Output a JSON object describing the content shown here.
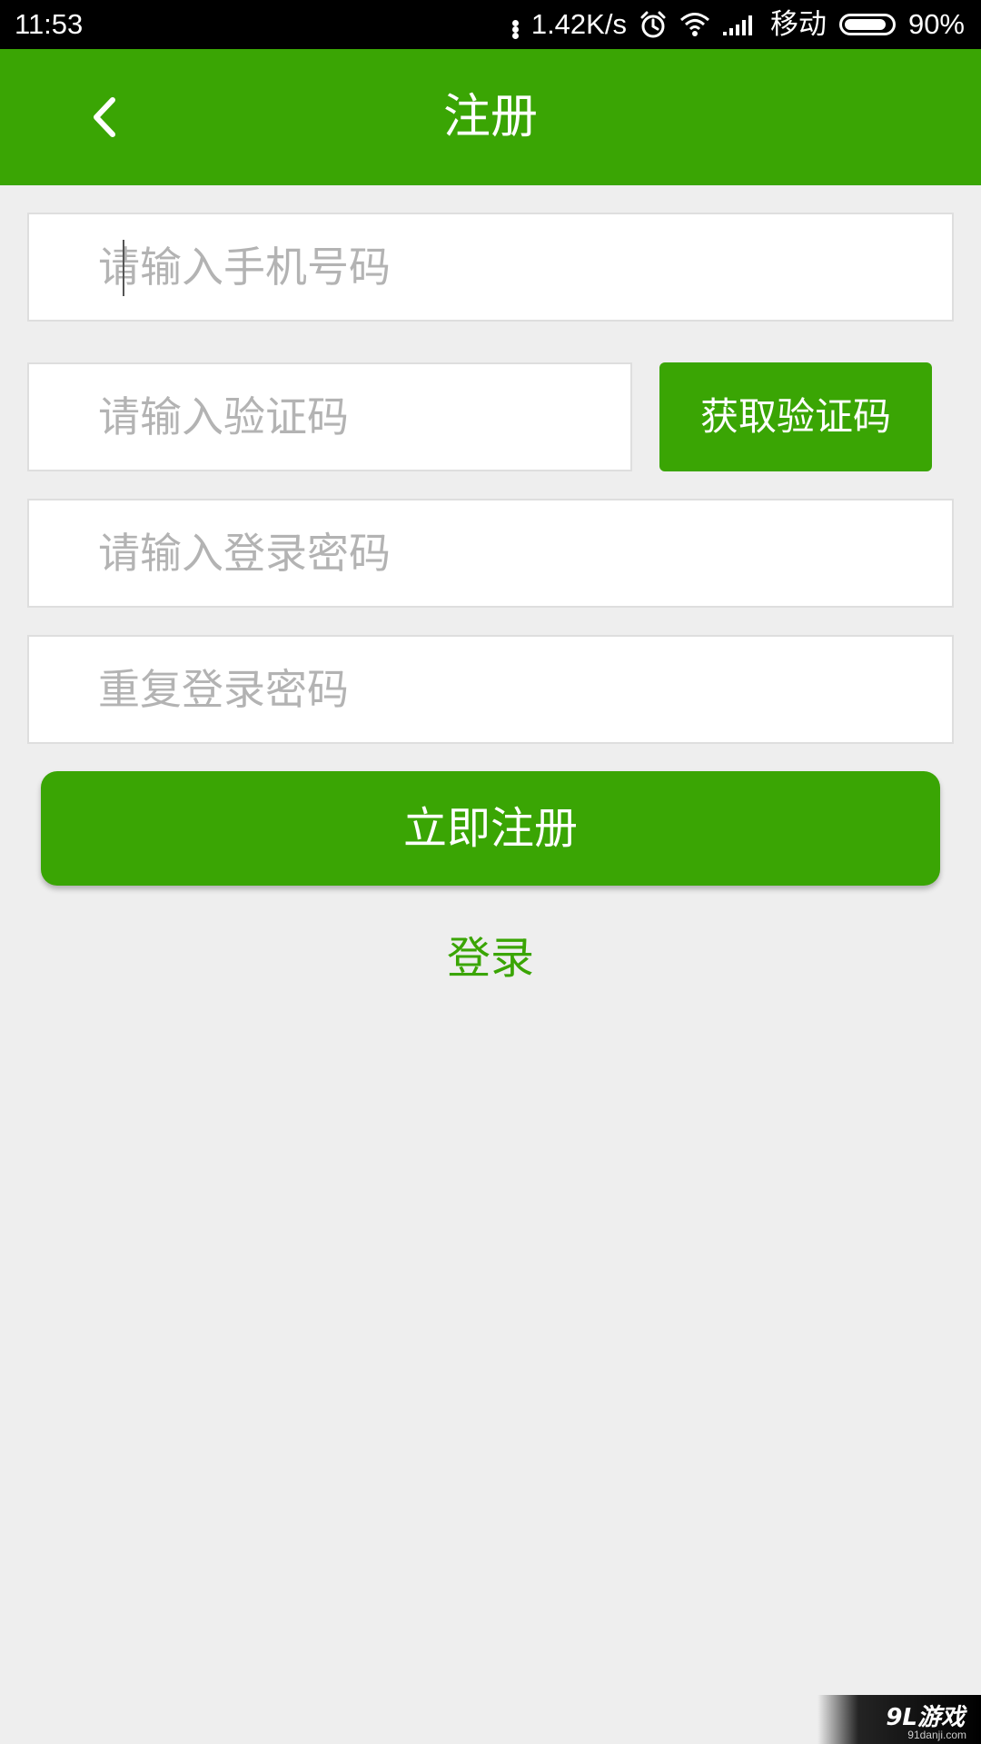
{
  "status_bar": {
    "time": "11:53",
    "net_speed": "1.42K/s",
    "carrier": "移动",
    "battery_percent": "90%",
    "battery_level": 0.9,
    "icons": [
      "more-dots-icon",
      "alarm-icon",
      "wifi-icon",
      "signal-icon",
      "battery-icon"
    ]
  },
  "header": {
    "title": "注册",
    "back_icon": "chevron-left-icon"
  },
  "form": {
    "phone_placeholder": "请输入手机号码",
    "code_placeholder": "请输入验证码",
    "get_code_label": "获取验证码",
    "password_placeholder": "请输入登录密码",
    "repeat_password_placeholder": "重复登录密码",
    "phone_value": "",
    "code_value": "",
    "password_value": "",
    "repeat_password_value": ""
  },
  "actions": {
    "register_label": "立即注册",
    "login_label": "登录"
  },
  "watermark": {
    "brand": "9L游戏",
    "url": "91danji.com"
  },
  "colors": {
    "accent": "#3aa504",
    "background": "#eeeeee",
    "placeholder": "#b3b3b3"
  }
}
